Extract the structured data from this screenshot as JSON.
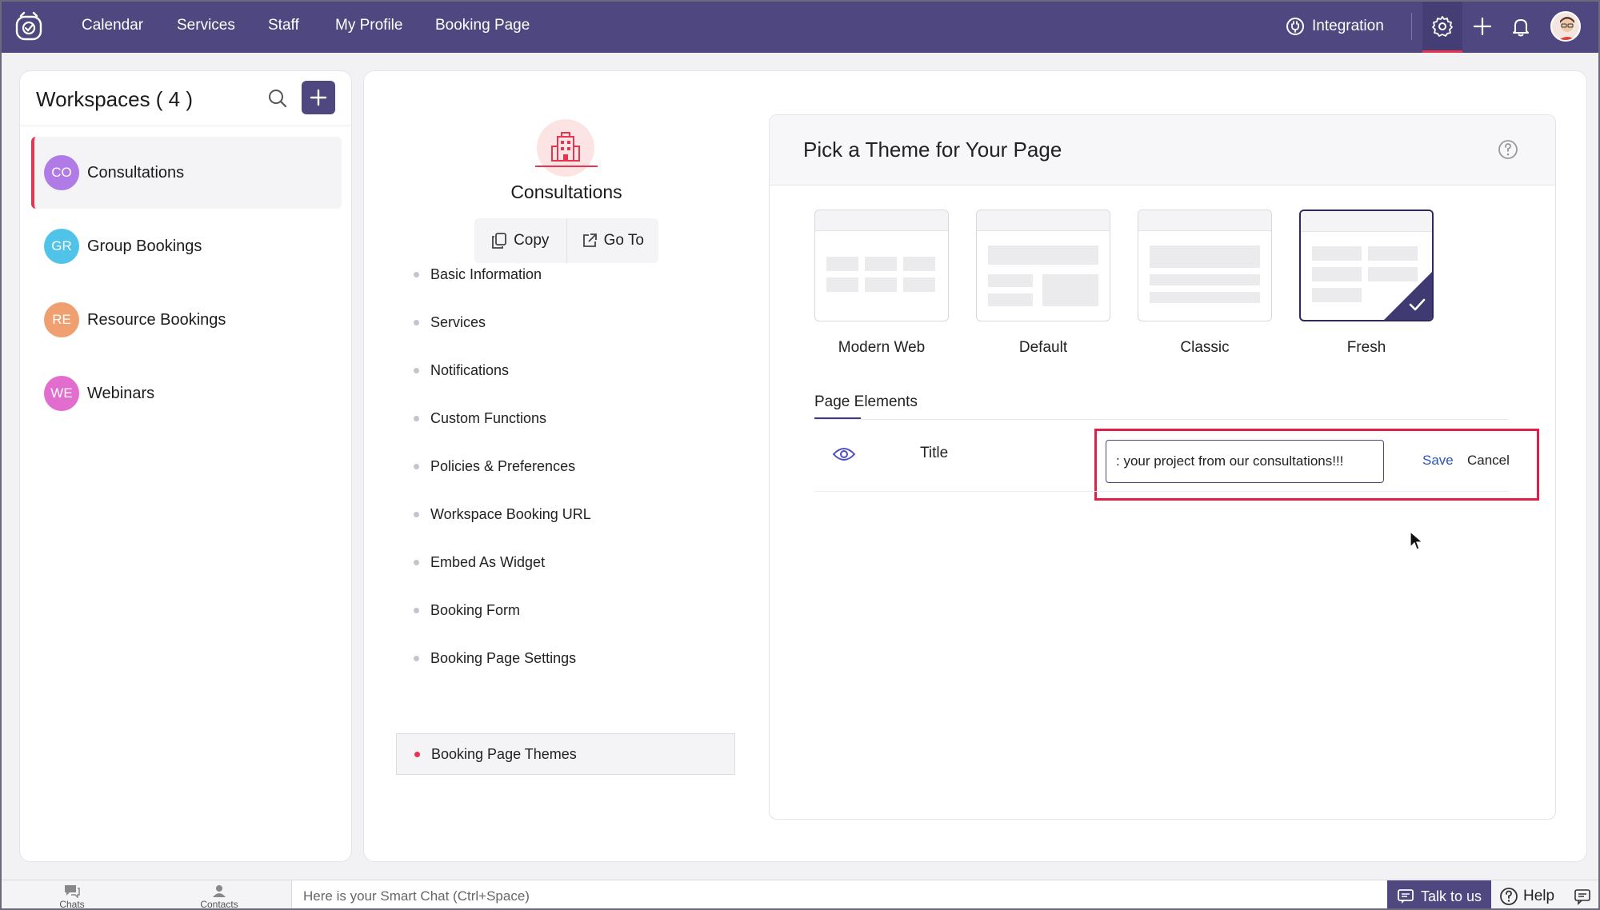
{
  "topnav": {
    "items": [
      "Calendar",
      "Services",
      "Staff",
      "My Profile",
      "Booking Page"
    ],
    "integration_label": "Integration",
    "icons": [
      "app-logo-icon",
      "integration-icon",
      "gear-icon",
      "plus-icon",
      "bell-icon",
      "avatar"
    ]
  },
  "workspaces": {
    "title": "Workspaces ( 4 )",
    "items": [
      {
        "initials": "CO",
        "label": "Consultations",
        "color": "#b07be6"
      },
      {
        "initials": "GR",
        "label": "Group Bookings",
        "color": "#4fc3e8"
      },
      {
        "initials": "RE",
        "label": "Resource Bookings",
        "color": "#f0a070"
      },
      {
        "initials": "WE",
        "label": "Webinars",
        "color": "#e36ccf"
      }
    ]
  },
  "workspace_detail": {
    "name": "Consultations",
    "copy_label": "Copy",
    "goto_label": "Go To",
    "menu": [
      "Basic Information",
      "Services",
      "Notifications",
      "Custom Functions",
      "Policies & Preferences",
      "Workspace Booking URL",
      "Embed As Widget",
      "Booking Form",
      "Booking Page Settings",
      "Booking Page Themes"
    ],
    "active_menu": "Booking Page Themes"
  },
  "themes": {
    "title": "Pick a Theme for Your Page",
    "options": [
      "Modern Web",
      "Default",
      "Classic",
      "Fresh"
    ],
    "selected": "Fresh",
    "page_elements_label": "Page Elements",
    "row": {
      "label": "Title",
      "input_value": ": your project from our consultations!!!",
      "save_label": "Save",
      "cancel_label": "Cancel"
    }
  },
  "bottombar": {
    "chats_label": "Chats",
    "contacts_label": "Contacts",
    "smart_chat_placeholder": "Here is your Smart Chat (Ctrl+Space)",
    "talk_label": "Talk to us",
    "help_label": "Help"
  },
  "colors": {
    "nav_bg": "#4e4780",
    "accent_red": "#e8354d",
    "highlight": "#e11d48",
    "link_blue": "#2a55b8"
  }
}
